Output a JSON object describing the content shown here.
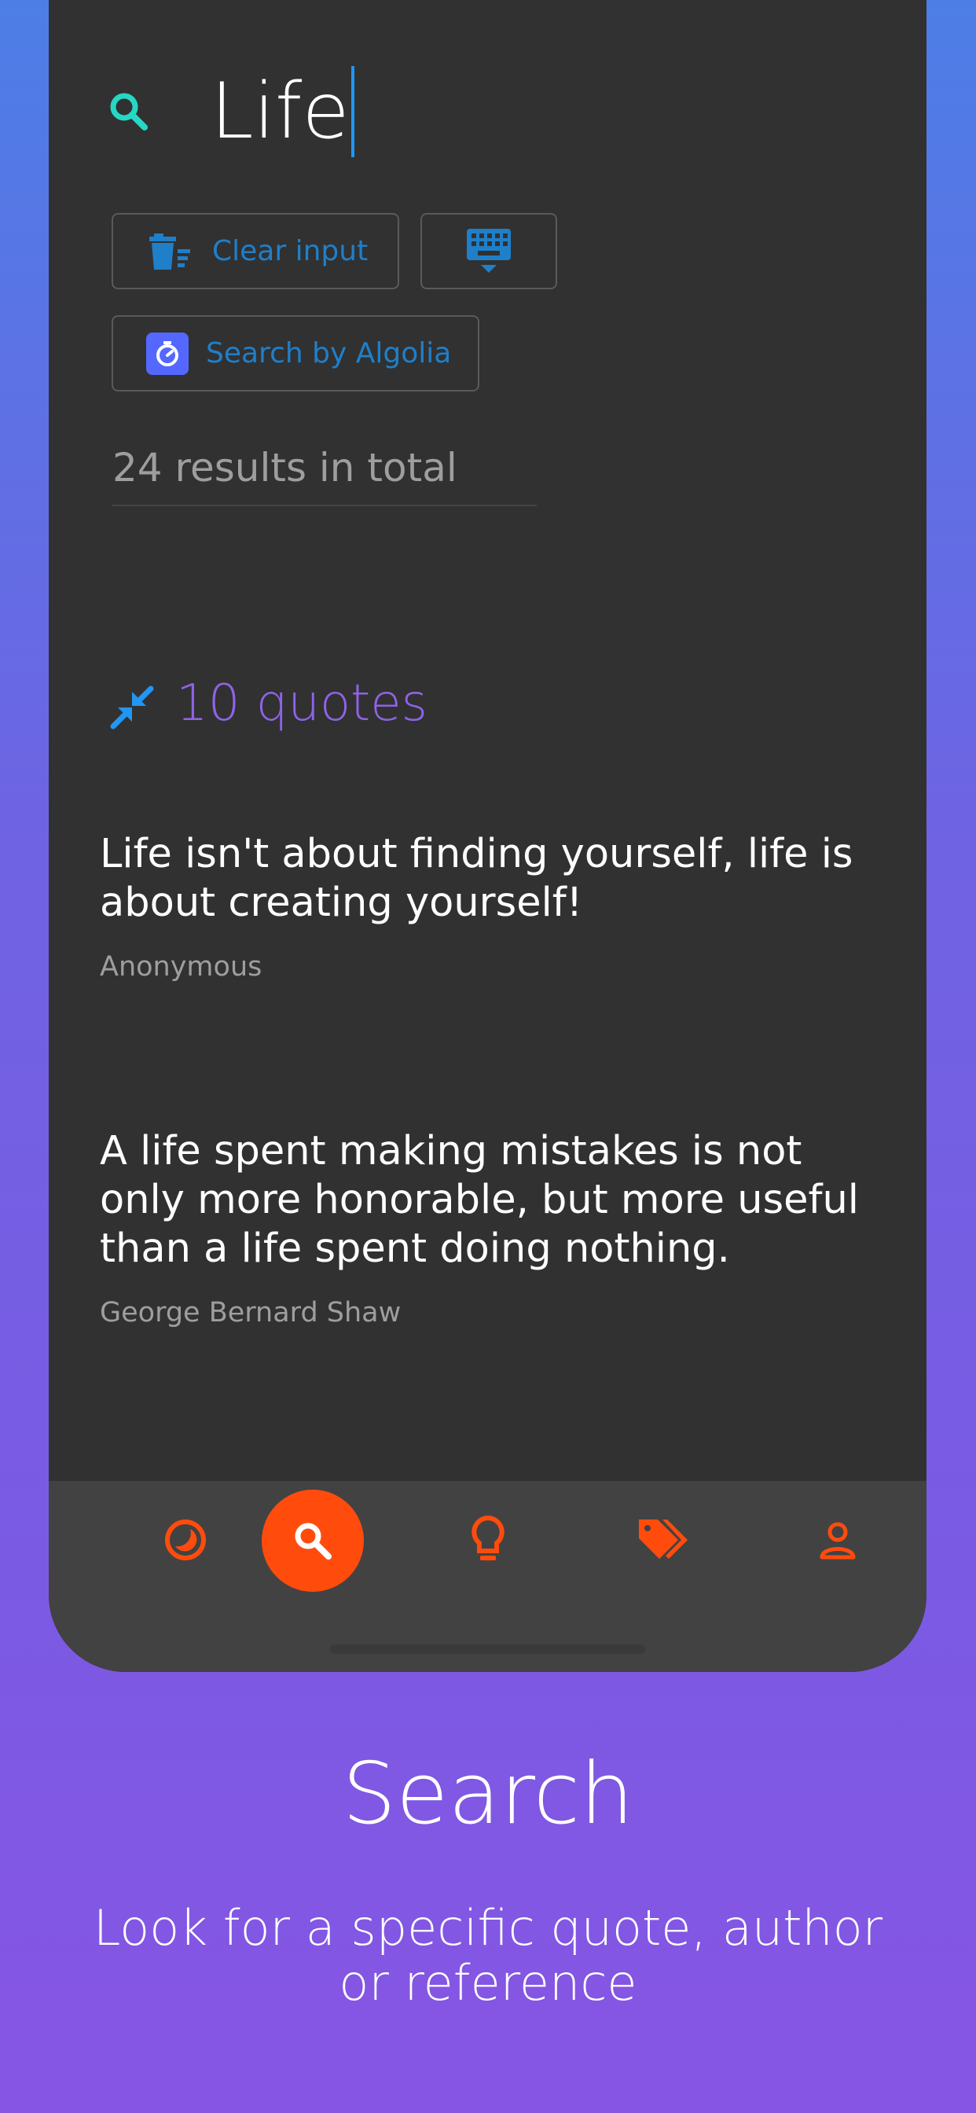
{
  "search": {
    "query": "Life"
  },
  "chips": {
    "clear_label": "Clear input",
    "algolia_label": "Search by Algolia"
  },
  "results": {
    "count_label": "24 results in total"
  },
  "section": {
    "quotes_count_label": "10 quotes"
  },
  "quotes": [
    {
      "text": "Life isn't about finding yourself, life is about creating yourself!",
      "author": "Anonymous"
    },
    {
      "text": "A life spent making mistakes is not only more honorable, but more useful than a life spent doing nothing.",
      "author": "George Bernard Shaw"
    }
  ],
  "nav": {
    "items": [
      {
        "icon": "moon-recent-icon",
        "active": false
      },
      {
        "icon": "search-icon",
        "active": true
      },
      {
        "icon": "lightbulb-icon",
        "active": false
      },
      {
        "icon": "tags-icon",
        "active": false
      },
      {
        "icon": "person-icon",
        "active": false
      }
    ]
  },
  "promo": {
    "title": "Search",
    "subtitle": "Look for a specific quote, author or reference"
  },
  "colors": {
    "accent_orange": "#ff4c0d",
    "chip_text_blue": "#1f7fc9",
    "search_icon_teal": "#26d7c4",
    "quotes_purple": "#8f63e8",
    "algolia_blue": "#5468ff"
  }
}
